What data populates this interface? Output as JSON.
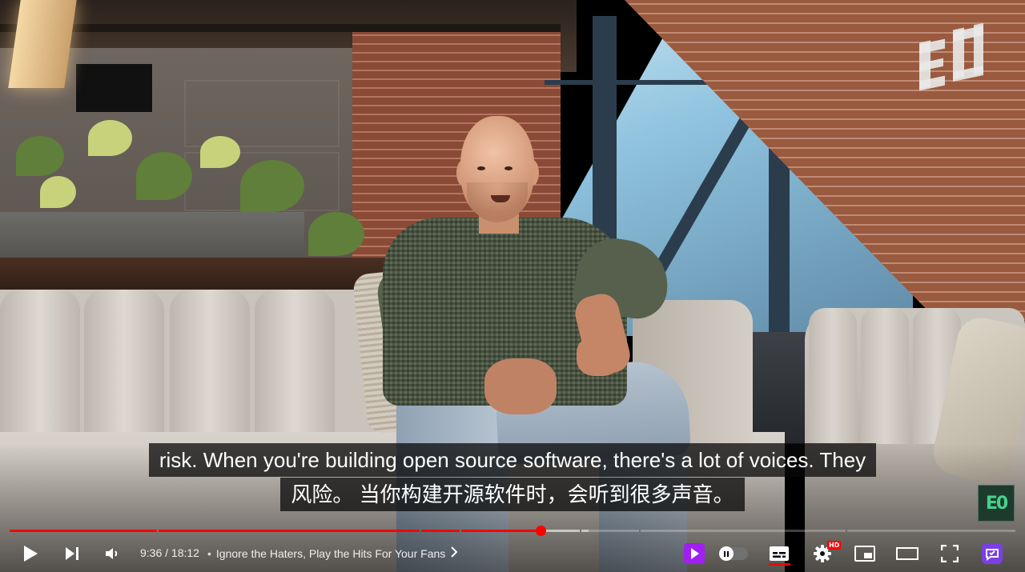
{
  "video": {
    "current_time": "9:36",
    "separator": "/",
    "duration": "18:12",
    "chapter_title": "Ignore the Haters, Play the Hits For Your Fans",
    "progress_fraction": 0.5275
  },
  "captions": {
    "line1": "risk. When you're building open source software, there's a lot of voices. They",
    "line2": "风险。 当你构建开源软件时，会听到很多声音。"
  },
  "settings": {
    "quality_badge": "HD"
  },
  "channel": {
    "branding_text": "E0"
  },
  "icons": {
    "play": "play-icon",
    "next": "next-icon",
    "volume": "volume-icon",
    "chapter_chevron": "chevron-right-icon",
    "premium": "play-square-icon",
    "autoplay": "autoplay-pause-icon",
    "subtitles": "subtitles-icon",
    "settings": "gear-icon",
    "miniplayer": "miniplayer-icon",
    "theater": "theater-mode-icon",
    "fullscreen": "fullscreen-icon",
    "extension": "extension-icon"
  },
  "colors": {
    "progress": "#ff0000",
    "premium": "#a020f0",
    "extension": "#7b3fe4",
    "branding_green": "#47d18c"
  }
}
